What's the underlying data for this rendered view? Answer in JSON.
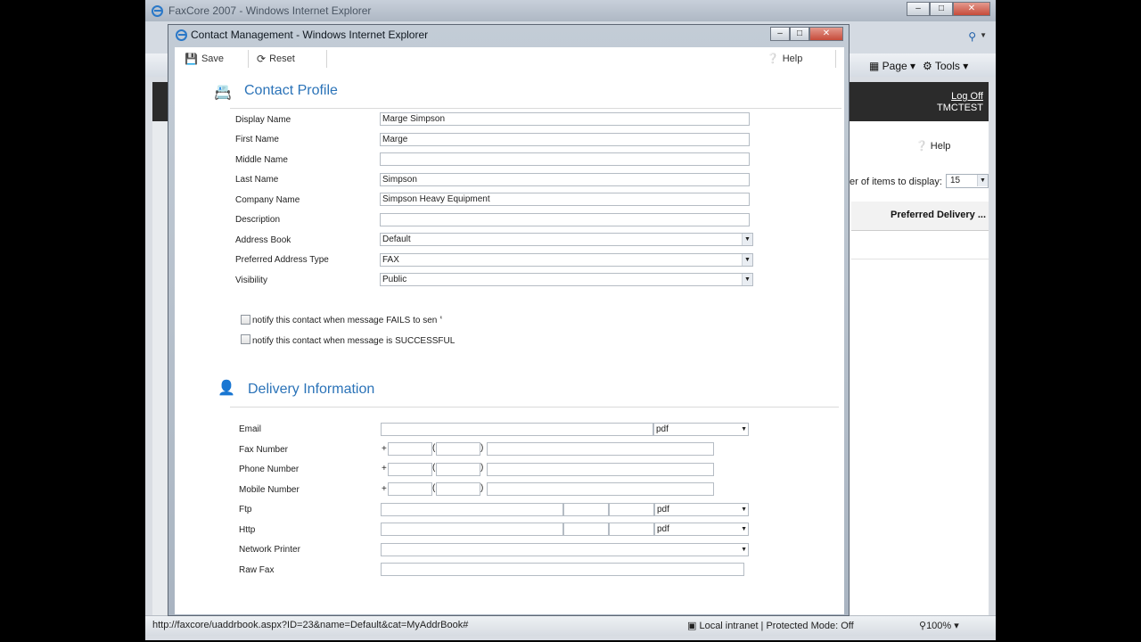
{
  "background_window": {
    "title": "FaxCore 2007 - Windows Internet Explorer",
    "cmd_page": "Page",
    "cmd_tools": "Tools",
    "log_off": "Log Off",
    "user": "TMCTEST",
    "help": "Help",
    "items_to_display_label": "er of items to display:",
    "items_to_display_value": "15",
    "column_preferred_delivery": "Preferred Delivery ...",
    "status_url": "http://faxcore/uaddrbook.aspx?ID=23&name=Default&cat=MyAddrBook#",
    "status_zone": "Local intranet | Protected Mode: Off",
    "status_zoom": "100%"
  },
  "popup": {
    "title": "Contact Management - Windows Internet Explorer",
    "toolbar": {
      "save": "Save",
      "reset": "Reset",
      "help": "Help"
    },
    "contact_profile": {
      "heading": "Contact Profile",
      "display_name": {
        "label": "Display Name",
        "value": "Marge Simpson"
      },
      "first_name": {
        "label": "First Name",
        "value": "Marge"
      },
      "middle_name": {
        "label": "Middle Name",
        "value": ""
      },
      "last_name": {
        "label": "Last Name",
        "value": "Simpson"
      },
      "company_name": {
        "label": "Company Name",
        "value": "Simpson Heavy Equipment"
      },
      "description": {
        "label": "Description",
        "value": ""
      },
      "address_book": {
        "label": "Address Book",
        "value": "Default"
      },
      "preferred_address_type": {
        "label": "Preferred Address Type",
        "value": "FAX"
      },
      "visibility": {
        "label": "Visibility",
        "value": "Public"
      },
      "notify_fail": "notify this contact when message FAILS to send",
      "notify_success": "notify this contact when message is SUCCESSFUL"
    },
    "delivery_information": {
      "heading": "Delivery Information",
      "email": {
        "label": "Email",
        "format": "pdf"
      },
      "fax_number": {
        "label": "Fax Number"
      },
      "phone_number": {
        "label": "Phone Number"
      },
      "mobile_number": {
        "label": "Mobile Number"
      },
      "ftp": {
        "label": "Ftp",
        "format": "pdf"
      },
      "http": {
        "label": "Http",
        "format": "pdf"
      },
      "network_printer": {
        "label": "Network Printer"
      },
      "raw_fax": {
        "label": "Raw Fax"
      }
    }
  }
}
